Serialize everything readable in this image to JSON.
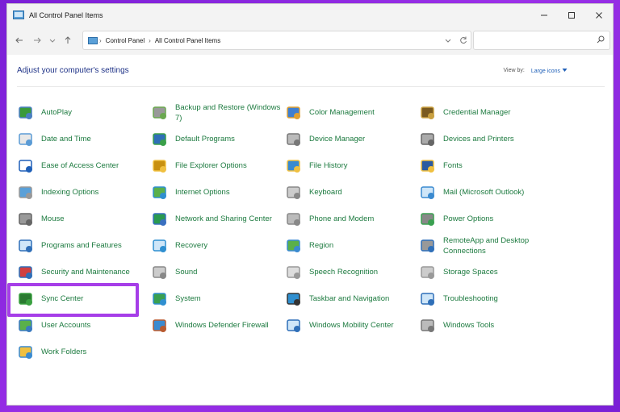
{
  "window": {
    "title": "All Control Panel Items"
  },
  "address": {
    "crumbs": [
      "Control Panel",
      "All Control Panel Items"
    ],
    "search_placeholder": ""
  },
  "content": {
    "heading": "Adjust your computer's settings",
    "view_by_label": "View by:",
    "view_by_value": "Large icons"
  },
  "items": [
    [
      "AutoPlay",
      "Backup and Restore (Windows 7)",
      "Color Management",
      "Credential Manager"
    ],
    [
      "Date and Time",
      "Default Programs",
      "Device Manager",
      "Devices and Printers"
    ],
    [
      "Ease of Access Center",
      "File Explorer Options",
      "File History",
      "Fonts"
    ],
    [
      "Indexing Options",
      "Internet Options",
      "Keyboard",
      "Mail (Microsoft Outlook)"
    ],
    [
      "Mouse",
      "Network and Sharing Center",
      "Phone and Modem",
      "Power Options"
    ],
    [
      "Programs and Features",
      "Recovery",
      "Region",
      "RemoteApp and Desktop Connections"
    ],
    [
      "Security and Maintenance",
      "Sound",
      "Speech Recognition",
      "Storage Spaces"
    ],
    [
      "Sync Center",
      "System",
      "Taskbar and Navigation",
      "Troubleshooting"
    ],
    [
      "User Accounts",
      "Windows Defender Firewall",
      "Windows Mobility Center",
      "Windows Tools"
    ],
    [
      "Work Folders",
      "",
      "",
      ""
    ]
  ],
  "icons": [
    [
      "autoplay-icon",
      "backup-restore-icon",
      "color-management-icon",
      "credential-manager-icon"
    ],
    [
      "date-time-icon",
      "default-programs-icon",
      "device-manager-icon",
      "devices-printers-icon"
    ],
    [
      "ease-of-access-icon",
      "file-explorer-options-icon",
      "file-history-icon",
      "fonts-icon"
    ],
    [
      "indexing-options-icon",
      "internet-options-icon",
      "keyboard-icon",
      "mail-icon"
    ],
    [
      "mouse-icon",
      "network-sharing-icon",
      "phone-modem-icon",
      "power-options-icon"
    ],
    [
      "programs-features-icon",
      "recovery-icon",
      "region-icon",
      "remoteapp-icon"
    ],
    [
      "security-maintenance-icon",
      "sound-icon",
      "speech-recognition-icon",
      "storage-spaces-icon"
    ],
    [
      "sync-center-icon",
      "system-icon",
      "taskbar-navigation-icon",
      "troubleshooting-icon"
    ],
    [
      "user-accounts-icon",
      "firewall-icon",
      "mobility-center-icon",
      "windows-tools-icon"
    ],
    [
      "work-folders-icon",
      "",
      "",
      ""
    ]
  ],
  "colors": {
    "link_green": "#1c7a3f",
    "heading_blue": "#1e3287",
    "highlight_purple": "#a63ee8",
    "background_purple": "#8a2be2"
  },
  "highlighted_item": "Programs and Features"
}
